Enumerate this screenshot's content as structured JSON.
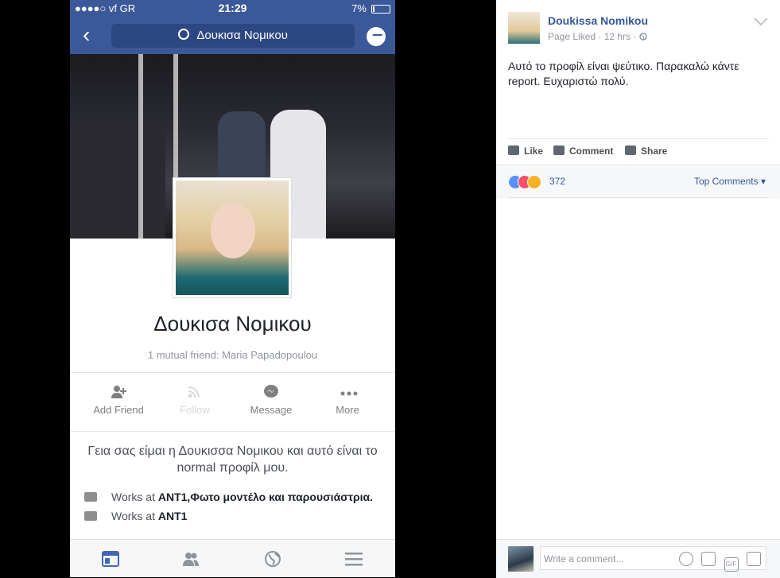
{
  "phone": {
    "status": {
      "carrier": "●●●●○ vf GR",
      "time": "21:29",
      "battery": "7%"
    },
    "nav": {
      "search_text": "Δουκισα Νομικου"
    },
    "profile": {
      "name": "Δουκισα Νομικου",
      "mutual": "1 mutual friend: Maria Papadopoulou",
      "actions": [
        {
          "label": "Add Friend",
          "icon": "add-friend-icon"
        },
        {
          "label": "Follow",
          "icon": "rss-icon"
        },
        {
          "label": "Message",
          "icon": "messenger-icon"
        },
        {
          "label": "More",
          "icon": "more-icon"
        }
      ],
      "bio": "Γεια σας είμαι η Δουκισσα Νομικου και αυτό είναι το normal προφίλ μου.",
      "work": [
        {
          "prefix": "Works at ",
          "bold": "ANT1,Φωτο μοντέλο και παρουσιάστρια."
        },
        {
          "prefix": "Works at ",
          "bold": "ANT1"
        }
      ]
    },
    "tabbar": [
      "news-feed-icon",
      "friends-icon",
      "globe-icon",
      "menu-icon"
    ]
  },
  "post": {
    "author": "Doukissa Nomikou",
    "meta": "Page Liked · 12 hrs · ",
    "text": "Αυτό το προφίλ είναι ψεύτικο. Παρακαλώ κάντε report. Ευχαριστώ πολύ.",
    "actions": {
      "like": "Like",
      "comment": "Comment",
      "share": "Share"
    },
    "reactions": {
      "count": "372",
      "sort": "Top Comments"
    },
    "composer": {
      "placeholder": "Write a comment..."
    }
  }
}
